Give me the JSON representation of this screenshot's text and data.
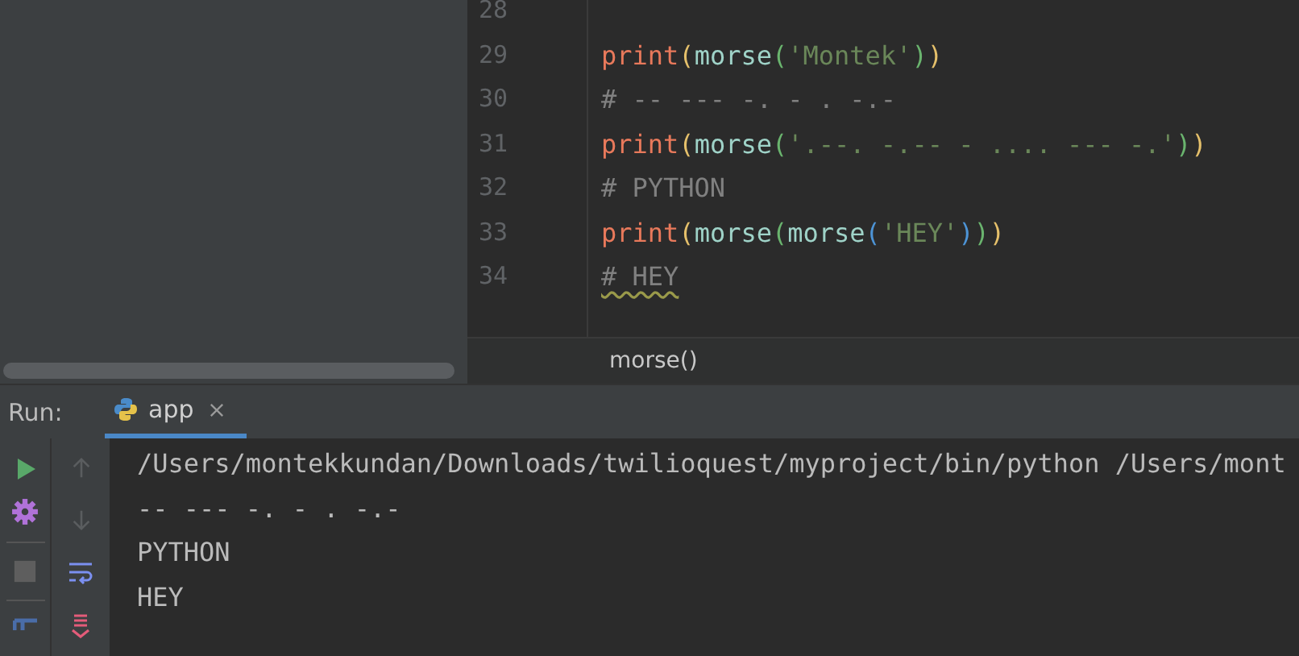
{
  "editor": {
    "lines": [
      {
        "number": "28"
      },
      {
        "number": "29",
        "tokens": [
          {
            "kind": "fn",
            "text": "print"
          },
          {
            "kind": "p1",
            "text": "("
          },
          {
            "kind": "ident",
            "text": "morse"
          },
          {
            "kind": "p2",
            "text": "("
          },
          {
            "kind": "string",
            "text": "'Montek'"
          },
          {
            "kind": "p2",
            "text": ")"
          },
          {
            "kind": "p1",
            "text": ")"
          }
        ]
      },
      {
        "number": "30",
        "tokens": [
          {
            "kind": "comment",
            "text": "# -- --- -. - . -.-"
          }
        ]
      },
      {
        "number": "31",
        "tokens": [
          {
            "kind": "fn",
            "text": "print"
          },
          {
            "kind": "p1",
            "text": "("
          },
          {
            "kind": "ident",
            "text": "morse"
          },
          {
            "kind": "p2",
            "text": "("
          },
          {
            "kind": "string",
            "text": "'.--. -.-- - .... --- -.'"
          },
          {
            "kind": "p2",
            "text": ")"
          },
          {
            "kind": "p1",
            "text": ")"
          }
        ]
      },
      {
        "number": "32",
        "tokens": [
          {
            "kind": "comment",
            "text": "# PYTHON"
          }
        ]
      },
      {
        "number": "33",
        "tokens": [
          {
            "kind": "fn",
            "text": "print"
          },
          {
            "kind": "p1",
            "text": "("
          },
          {
            "kind": "ident",
            "text": "morse"
          },
          {
            "kind": "p2",
            "text": "("
          },
          {
            "kind": "ident",
            "text": "morse"
          },
          {
            "kind": "p3",
            "text": "("
          },
          {
            "kind": "string",
            "text": "'HEY'"
          },
          {
            "kind": "p3",
            "text": ")"
          },
          {
            "kind": "p2",
            "text": ")"
          },
          {
            "kind": "p1",
            "text": ")"
          }
        ]
      },
      {
        "number": "34",
        "tokens": [
          {
            "kind": "typo",
            "text": "# HEY"
          }
        ]
      }
    ],
    "breadcrumb": "morse()"
  },
  "run_panel": {
    "label": "Run:",
    "tabs": [
      {
        "label": "app",
        "selected": true
      }
    ],
    "output": [
      "/Users/montekkundan/Downloads/twilioquest/myproject/bin/python /Users/mont",
      "-- --- -. - . -.-",
      "PYTHON",
      "HEY"
    ]
  }
}
